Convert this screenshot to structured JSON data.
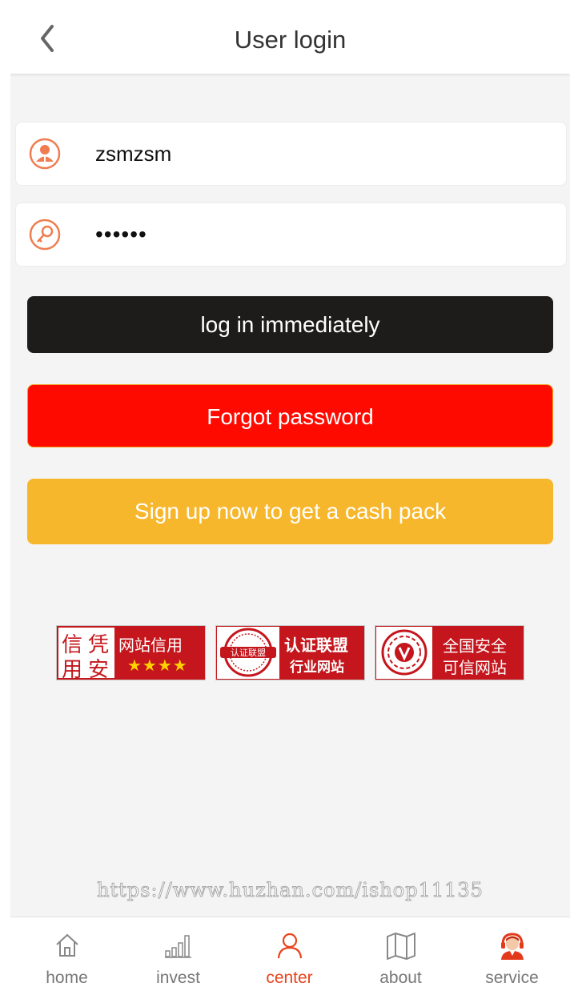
{
  "header": {
    "title": "User login",
    "back_icon": "chevron-left-icon"
  },
  "form": {
    "username": {
      "icon": "user-icon",
      "value": "zsmzsm"
    },
    "password": {
      "icon": "key-icon",
      "value": "••••••"
    }
  },
  "buttons": {
    "login": "log in immediately",
    "forgot": "Forgot password",
    "signup": "Sign up now to get a cash pack"
  },
  "badges": [
    {
      "name": "credit-badge",
      "chars": [
        "信",
        "凭",
        "用",
        "安"
      ],
      "text": "网站信用",
      "stars": "★★★★"
    },
    {
      "name": "certification-badge",
      "seal": "认证联盟",
      "line1": "认证联盟",
      "line2": "行业网站"
    },
    {
      "name": "security-badge",
      "line1": "全国安全",
      "line2": "可信网站"
    }
  ],
  "watermark": "https://www.huzhan.com/ishop11135",
  "tabs": [
    {
      "label": "home",
      "icon": "home-icon"
    },
    {
      "label": "invest",
      "icon": "bar-chart-icon"
    },
    {
      "label": "center",
      "icon": "person-icon",
      "active": true
    },
    {
      "label": "about",
      "icon": "map-icon"
    },
    {
      "label": "service",
      "icon": "customer-service-icon"
    }
  ],
  "colors": {
    "accent": "#e8421c",
    "login_button": "#1d1c1a",
    "forgot_button": "#ff0a00",
    "signup_button": "#f7b72c",
    "icon_orange": "#ef7d4f"
  }
}
